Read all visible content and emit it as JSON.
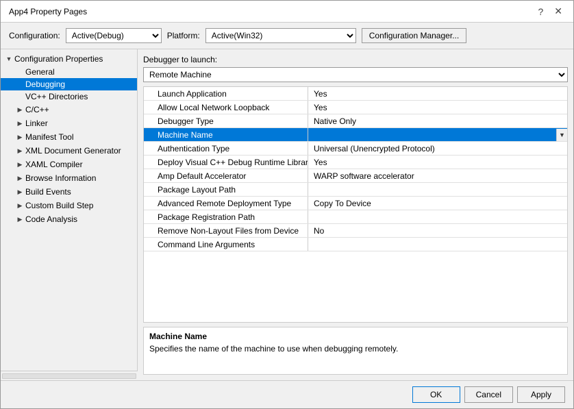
{
  "dialog": {
    "title": "App4 Property Pages",
    "title_icon": "app-icon"
  },
  "title_buttons": {
    "help": "?",
    "close": "✕"
  },
  "toolbar": {
    "config_label": "Configuration:",
    "config_value": "Active(Debug)",
    "platform_label": "Platform:",
    "platform_value": "Active(Win32)",
    "config_manager_label": "Configuration Manager..."
  },
  "sidebar": {
    "items": [
      {
        "id": "config-props",
        "label": "Configuration Properties",
        "indent": 0,
        "expanded": true,
        "toggle": "▼"
      },
      {
        "id": "general",
        "label": "General",
        "indent": 1,
        "expanded": false,
        "toggle": ""
      },
      {
        "id": "debugging",
        "label": "Debugging",
        "indent": 1,
        "expanded": false,
        "toggle": "",
        "selected": true
      },
      {
        "id": "vc-dirs",
        "label": "VC++ Directories",
        "indent": 1,
        "expanded": false,
        "toggle": ""
      },
      {
        "id": "c-cpp",
        "label": "C/C++",
        "indent": 1,
        "expanded": false,
        "toggle": "▶"
      },
      {
        "id": "linker",
        "label": "Linker",
        "indent": 1,
        "expanded": false,
        "toggle": "▶"
      },
      {
        "id": "manifest-tool",
        "label": "Manifest Tool",
        "indent": 1,
        "expanded": false,
        "toggle": "▶"
      },
      {
        "id": "xml-doc",
        "label": "XML Document Generator",
        "indent": 1,
        "expanded": false,
        "toggle": "▶"
      },
      {
        "id": "xaml-compiler",
        "label": "XAML Compiler",
        "indent": 1,
        "expanded": false,
        "toggle": "▶"
      },
      {
        "id": "browse-info",
        "label": "Browse Information",
        "indent": 1,
        "expanded": false,
        "toggle": "▶"
      },
      {
        "id": "build-events",
        "label": "Build Events",
        "indent": 1,
        "expanded": false,
        "toggle": "▶"
      },
      {
        "id": "custom-build",
        "label": "Custom Build Step",
        "indent": 1,
        "expanded": false,
        "toggle": "▶"
      },
      {
        "id": "code-analysis",
        "label": "Code Analysis",
        "indent": 1,
        "expanded": false,
        "toggle": "▶"
      }
    ]
  },
  "main": {
    "debugger_label": "Debugger to launch:",
    "debugger_value": "Remote Machine",
    "properties": [
      {
        "name": "Launch Application",
        "value": "Yes",
        "selected": false,
        "has_dropdown": false
      },
      {
        "name": "Allow Local Network Loopback",
        "value": "Yes",
        "selected": false,
        "has_dropdown": false
      },
      {
        "name": "Debugger Type",
        "value": "Native Only",
        "selected": false,
        "has_dropdown": false
      },
      {
        "name": "Machine Name",
        "value": "",
        "selected": true,
        "has_dropdown": true
      },
      {
        "name": "Authentication Type",
        "value": "Universal (Unencrypted Protocol)",
        "selected": false,
        "has_dropdown": false
      },
      {
        "name": "Deploy Visual C++ Debug Runtime Libraries",
        "value": "Yes",
        "selected": false,
        "has_dropdown": false
      },
      {
        "name": "Amp Default Accelerator",
        "value": "WARP software accelerator",
        "selected": false,
        "has_dropdown": false
      },
      {
        "name": "Package Layout Path",
        "value": "",
        "selected": false,
        "has_dropdown": false
      },
      {
        "name": "Advanced Remote Deployment Type",
        "value": "Copy To Device",
        "selected": false,
        "has_dropdown": false
      },
      {
        "name": "Package Registration Path",
        "value": "",
        "selected": false,
        "has_dropdown": false
      },
      {
        "name": "Remove Non-Layout Files from Device",
        "value": "No",
        "selected": false,
        "has_dropdown": false
      },
      {
        "name": "Command Line Arguments",
        "value": "",
        "selected": false,
        "has_dropdown": false
      }
    ],
    "info": {
      "title": "Machine Name",
      "description": "Specifies the name of the machine to use when debugging remotely."
    }
  },
  "buttons": {
    "ok": "OK",
    "cancel": "Cancel",
    "apply": "Apply"
  }
}
